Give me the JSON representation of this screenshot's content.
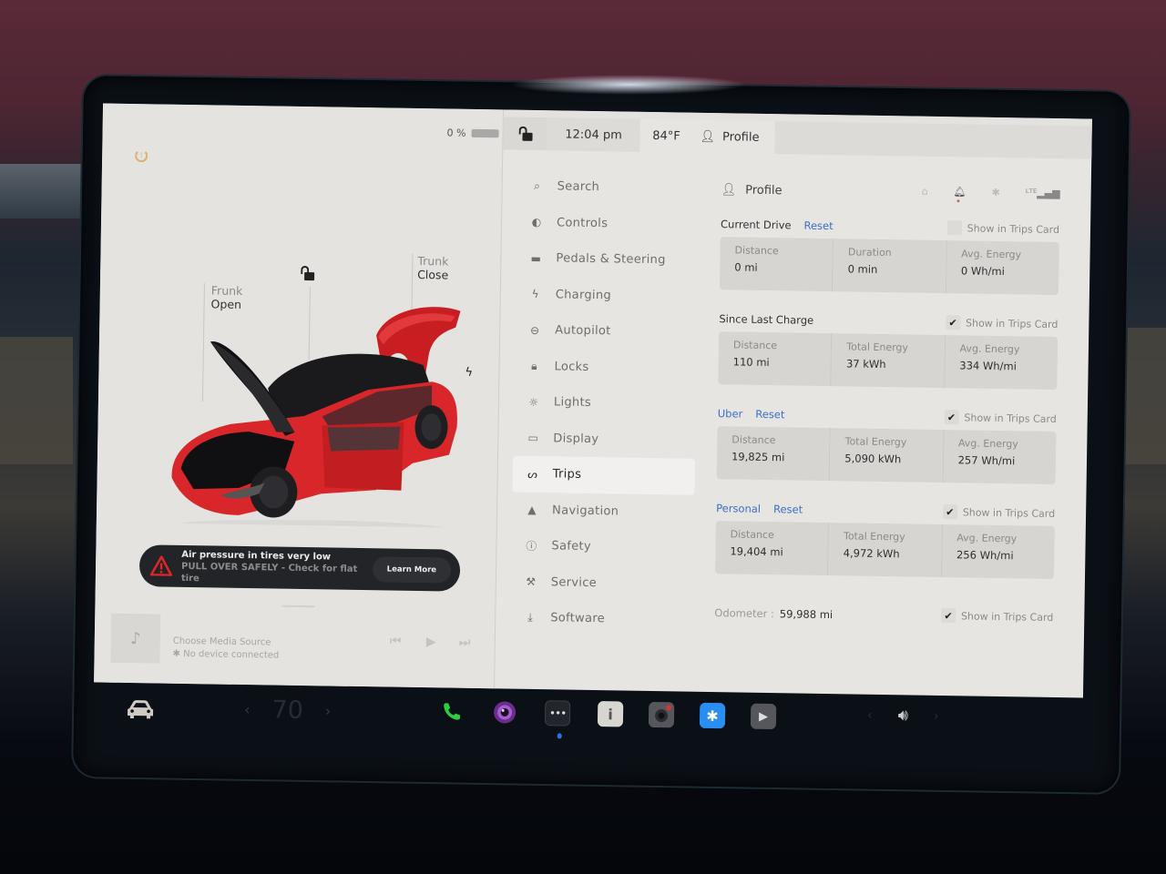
{
  "status_bar": {
    "battery_percent": "0 %",
    "battery_level": 0,
    "time": "12:04 pm",
    "temperature": "84°F",
    "profile_label": "Profile"
  },
  "car_view": {
    "frunk": {
      "label": "Frunk",
      "state": "Open"
    },
    "trunk": {
      "label": "Trunk",
      "state": "Close"
    },
    "car_color": "#d8262a"
  },
  "alert": {
    "title": "Air pressure in tires very low",
    "subtitle": "PULL OVER SAFELY - Check for flat tire",
    "button_label": "Learn More",
    "icon_color": "#e0262b"
  },
  "media": {
    "title": "Choose Media Source",
    "subtitle": "No device connected"
  },
  "menu": {
    "items": [
      {
        "label": "Search",
        "icon": "search-icon"
      },
      {
        "label": "Controls",
        "icon": "toggle-icon"
      },
      {
        "label": "Pedals & Steering",
        "icon": "car-icon"
      },
      {
        "label": "Charging",
        "icon": "bolt-icon"
      },
      {
        "label": "Autopilot",
        "icon": "steering-wheel-icon"
      },
      {
        "label": "Locks",
        "icon": "lock-icon"
      },
      {
        "label": "Lights",
        "icon": "light-icon"
      },
      {
        "label": "Display",
        "icon": "display-icon"
      },
      {
        "label": "Trips",
        "icon": "trips-icon",
        "active": true
      },
      {
        "label": "Navigation",
        "icon": "navigation-icon"
      },
      {
        "label": "Safety",
        "icon": "safety-icon"
      },
      {
        "label": "Service",
        "icon": "wrench-icon"
      },
      {
        "label": "Software",
        "icon": "download-icon"
      }
    ]
  },
  "trips": {
    "profile_label": "Profile",
    "show_card_label": "Show in Trips Card",
    "reset_label": "Reset",
    "sections": [
      {
        "title": "Current Drive",
        "has_reset": true,
        "title_blue": false,
        "show_in_card": false,
        "stats": [
          {
            "label": "Distance",
            "value": "0 mi"
          },
          {
            "label": "Duration",
            "value": "0 min"
          },
          {
            "label": "Avg. Energy",
            "value": "0 Wh/mi"
          }
        ]
      },
      {
        "title": "Since Last Charge",
        "has_reset": false,
        "title_blue": false,
        "show_in_card": true,
        "stats": [
          {
            "label": "Distance",
            "value": "110 mi"
          },
          {
            "label": "Total Energy",
            "value": "37 kWh"
          },
          {
            "label": "Avg. Energy",
            "value": "334 Wh/mi"
          }
        ]
      },
      {
        "title": "Uber",
        "has_reset": true,
        "title_blue": true,
        "show_in_card": true,
        "stats": [
          {
            "label": "Distance",
            "value": "19,825 mi"
          },
          {
            "label": "Total Energy",
            "value": "5,090 kWh"
          },
          {
            "label": "Avg. Energy",
            "value": "257 Wh/mi"
          }
        ]
      },
      {
        "title": "Personal",
        "has_reset": true,
        "title_blue": true,
        "show_in_card": true,
        "stats": [
          {
            "label": "Distance",
            "value": "19,404 mi"
          },
          {
            "label": "Total Energy",
            "value": "4,972 kWh"
          },
          {
            "label": "Avg. Energy",
            "value": "256 Wh/mi"
          }
        ]
      }
    ],
    "odometer": {
      "label": "Odometer :",
      "value": "59,988 mi",
      "show_in_card": true
    }
  },
  "taskbar": {
    "speed_setting": "70",
    "apps": [
      {
        "name": "phone",
        "color": "#2ecc40"
      },
      {
        "name": "camera",
        "color": "#7a3aa0"
      },
      {
        "name": "more-apps",
        "color": "#2a2d33"
      },
      {
        "name": "manual",
        "color": "#d8d6d0"
      },
      {
        "name": "dashcam",
        "color": "#55575c"
      },
      {
        "name": "bluetooth",
        "color": "#2a8ef0"
      },
      {
        "name": "theater",
        "color": "#55575c"
      }
    ]
  }
}
